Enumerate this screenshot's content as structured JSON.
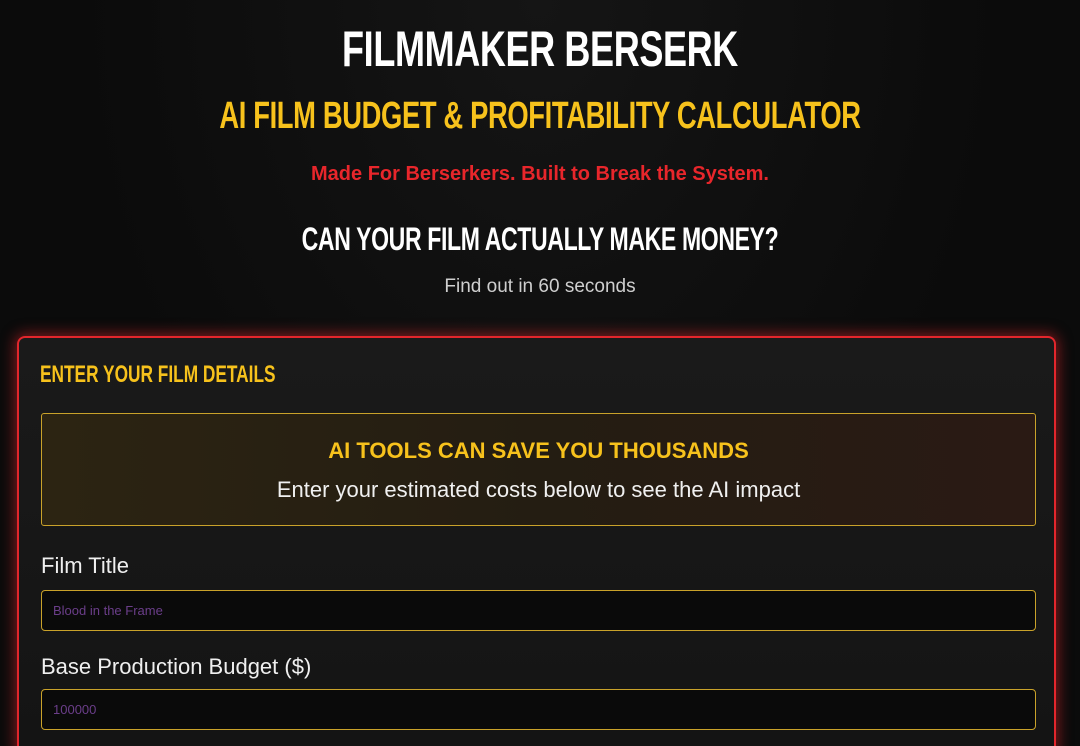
{
  "header": {
    "title": "FILMMAKER BERSERK",
    "subtitle": "AI FILM BUDGET & PROFITABILITY CALCULATOR",
    "tagline": "Made For Berserkers. Built to Break the System.",
    "headline": "CAN YOUR FILM ACTUALLY MAKE MONEY?",
    "subline": "Find out in 60 seconds"
  },
  "form": {
    "section_title": "ENTER YOUR FILM DETAILS",
    "ai_box": {
      "title": "AI TOOLS CAN SAVE YOU THOUSANDS",
      "text": "Enter your estimated costs below to see the AI impact"
    },
    "fields": [
      {
        "label": "Film Title",
        "value": "",
        "placeholder": "Blood in the Frame"
      },
      {
        "label": "Base Production Budget ($)",
        "value": "",
        "placeholder": "100000"
      }
    ]
  },
  "colors": {
    "accent_yellow": "#f7c21c",
    "accent_red": "#e3262c",
    "background": "#0b0b0b",
    "placeholder": "#6b3e8a"
  }
}
